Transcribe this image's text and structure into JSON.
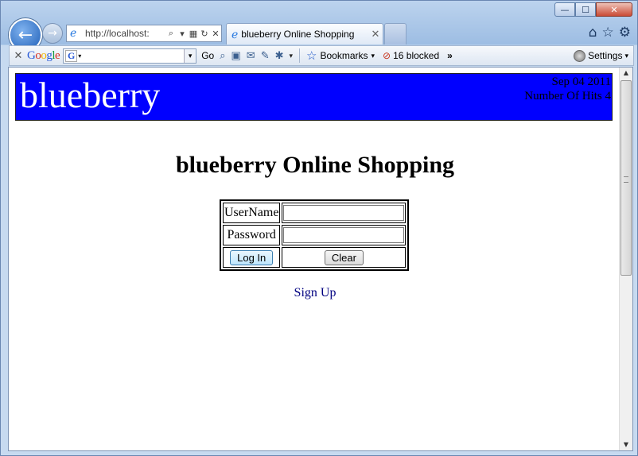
{
  "browser": {
    "window_controls": {
      "minimize": "—",
      "maximize": "☐",
      "close": "✕"
    },
    "address_bar": {
      "url": "http://localhost:"
    },
    "tab": {
      "title": "blueberry Online Shopping"
    },
    "toolbar": {
      "google_logo": [
        "G",
        "o",
        "o",
        "g",
        "l",
        "e"
      ],
      "search_g": "G",
      "go_label": "Go",
      "bookmarks_label": "Bookmarks",
      "blocked_label": "16 blocked",
      "more": "»",
      "settings_label": "Settings"
    }
  },
  "page": {
    "brand": "blueberry",
    "date": "Sep 04 2011",
    "hits": "Number Of Hits 4",
    "heading": "blueberry Online Shopping",
    "form": {
      "username_label": "UserName",
      "password_label": "Password",
      "username_value": "",
      "password_value": "",
      "login_label": "Log In",
      "clear_label": "Clear"
    },
    "signup_label": "Sign Up"
  }
}
